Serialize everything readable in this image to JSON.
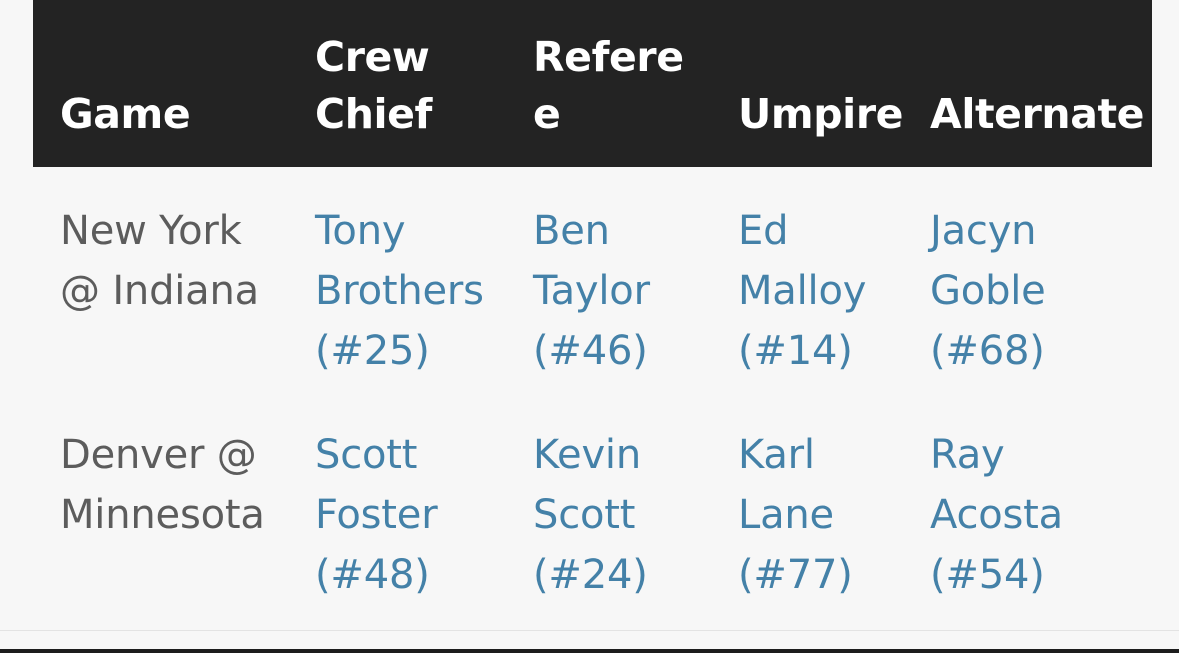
{
  "table": {
    "columns": [
      {
        "key": "game",
        "label": "Game"
      },
      {
        "key": "chief",
        "label": "Crew Chief"
      },
      {
        "key": "referee",
        "label": "Referee"
      },
      {
        "key": "umpire",
        "label": "Umpire"
      },
      {
        "key": "alternate",
        "label": "Alternate"
      }
    ],
    "rows": [
      {
        "game": "New York @ Indiana",
        "chief": "Tony Brothers (#25)",
        "referee": "Ben Taylor (#46)",
        "umpire": "Ed Malloy (#14)",
        "alternate": "Jacyn Goble (#68)"
      },
      {
        "game": "Denver @ Minnesota",
        "chief": "Scott Foster (#48)",
        "referee": "Kevin Scott (#24)",
        "umpire": "Karl Lane (#77)",
        "alternate": "Ray Acosta (#54)"
      }
    ]
  },
  "colors": {
    "page_background": "#f7f7f7",
    "header_background": "#232323",
    "header_text": "#ffffff",
    "game_text": "#5c5c5c",
    "official_link": "#4481a8",
    "divider": "#e3e3e3",
    "bottom_edge": "#1d1d1d"
  }
}
